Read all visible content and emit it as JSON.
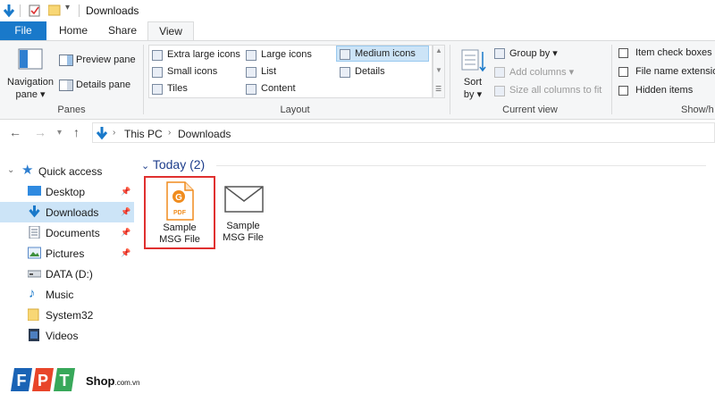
{
  "window": {
    "title": "Downloads"
  },
  "tabs": [
    "File",
    "Home",
    "Share",
    "View"
  ],
  "ribbon": {
    "panes": {
      "navigation_pane_line1": "Navigation",
      "navigation_pane_line2": "pane",
      "preview_pane": "Preview pane",
      "details_pane": "Details pane",
      "label": "Panes"
    },
    "layout": {
      "items": [
        "Extra large icons",
        "Large icons",
        "Medium icons",
        "Small icons",
        "List",
        "Details",
        "Tiles",
        "Content"
      ],
      "label": "Layout"
    },
    "current_view": {
      "sort_line1": "Sort",
      "sort_line2": "by",
      "group_by": "Group by",
      "add_columns": "Add columns",
      "size_all_columns": "Size all columns to fit",
      "label": "Current view"
    },
    "show_hide": {
      "item_check_boxes": "Item check boxes",
      "file_name_extensions": "File name extensio",
      "hidden_items": "Hidden items",
      "label": "Show/h"
    }
  },
  "address": {
    "crumbs": [
      "This PC",
      "Downloads"
    ]
  },
  "sidebar": {
    "quick_access": "Quick access",
    "items": [
      {
        "label": "Desktop",
        "pinned": true
      },
      {
        "label": "Downloads",
        "pinned": true
      },
      {
        "label": "Documents",
        "pinned": true
      },
      {
        "label": "Pictures",
        "pinned": true
      },
      {
        "label": "DATA (D:)",
        "pinned": false
      },
      {
        "label": "Music",
        "pinned": false
      },
      {
        "label": "System32",
        "pinned": false
      },
      {
        "label": "Videos",
        "pinned": false
      }
    ]
  },
  "content": {
    "group_header": "Today (2)",
    "files": [
      {
        "name_line1": "Sample",
        "name_line2": "MSG File",
        "icon": "pdf-icon",
        "selected": true
      },
      {
        "name_line1": "Sample",
        "name_line2": "MSG File",
        "icon": "envelope-icon",
        "selected": false
      }
    ]
  },
  "watermark": {
    "logo": "FPT",
    "text": "Shop",
    "suffix": ".com.vn"
  },
  "colors": {
    "accent": "#1979ca",
    "selection": "#cce4f7",
    "highlight_border": "#e0302f",
    "group_header": "#1e3e8c",
    "pdf_orange": "#f08c1e"
  }
}
